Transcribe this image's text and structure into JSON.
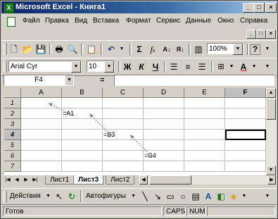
{
  "window": {
    "title": "Microsoft Excel - Книга1",
    "app_icon": "excel-icon",
    "controls": [
      "minimize-icon",
      "maximize-icon",
      "close-icon"
    ]
  },
  "menu": {
    "items": [
      "Файл",
      "Правка",
      "Вид",
      "Вставка",
      "Формат",
      "Сервис",
      "Данные",
      "Окно",
      "Справка"
    ]
  },
  "standard_toolbar": {
    "icons": [
      "new-icon",
      "open-icon",
      "save-icon",
      "print-icon",
      "print-preview-icon",
      "paste-icon",
      "undo-icon",
      "autosum-icon",
      "function-icon",
      "sort-ascending-icon",
      "sort-descending-icon",
      "chart-icon",
      "help-icon"
    ],
    "zoom": "100%"
  },
  "format_toolbar": {
    "font": "Arial Cyr",
    "size": "10",
    "bold": "Ж",
    "italic": "К",
    "underline": "Ч",
    "icons": [
      "align-left-icon",
      "align-center-icon",
      "align-right-icon",
      "borders-icon",
      "font-color-icon"
    ]
  },
  "formula_bar": {
    "name_box": "F4",
    "equals": "=",
    "value": ""
  },
  "sheet": {
    "columns": [
      "A",
      "B",
      "C",
      "D",
      "E",
      "F"
    ],
    "rows": [
      "1",
      "2",
      "3",
      "4",
      "5",
      "6",
      "7"
    ],
    "active_cell": "F4",
    "cells": [
      {
        "ref": "B2",
        "value": "=A1"
      },
      {
        "ref": "C4",
        "value": "=B3"
      },
      {
        "ref": "D6",
        "value": "=C4"
      }
    ],
    "trace_arrows": [
      {
        "from": "D6",
        "to": "C4"
      },
      {
        "from": "C4",
        "to": "B2"
      },
      {
        "from": "B2",
        "to": "A1"
      }
    ]
  },
  "tabs": {
    "items": [
      "Лист1",
      "Лист3",
      "Лист2"
    ],
    "selected": "Лист3"
  },
  "drawing_toolbar": {
    "actions_label": "Действия",
    "autoshapes_label": "Автофигуры",
    "icons": [
      "select-objects-icon",
      "free-rotate-icon",
      "line-icon",
      "arrow-icon",
      "rectangle-icon",
      "oval-icon",
      "textbox-icon",
      "wordart-icon",
      "fill-color-icon"
    ]
  },
  "status_bar": {
    "state": "Готов",
    "caps": "CAPS",
    "num": "NUM"
  },
  "colors": {
    "title_gradient_start": "#0a246a",
    "title_gradient_end": "#a6caf0",
    "chrome": "#d4d0c8",
    "trace_arrow": "#808080"
  }
}
